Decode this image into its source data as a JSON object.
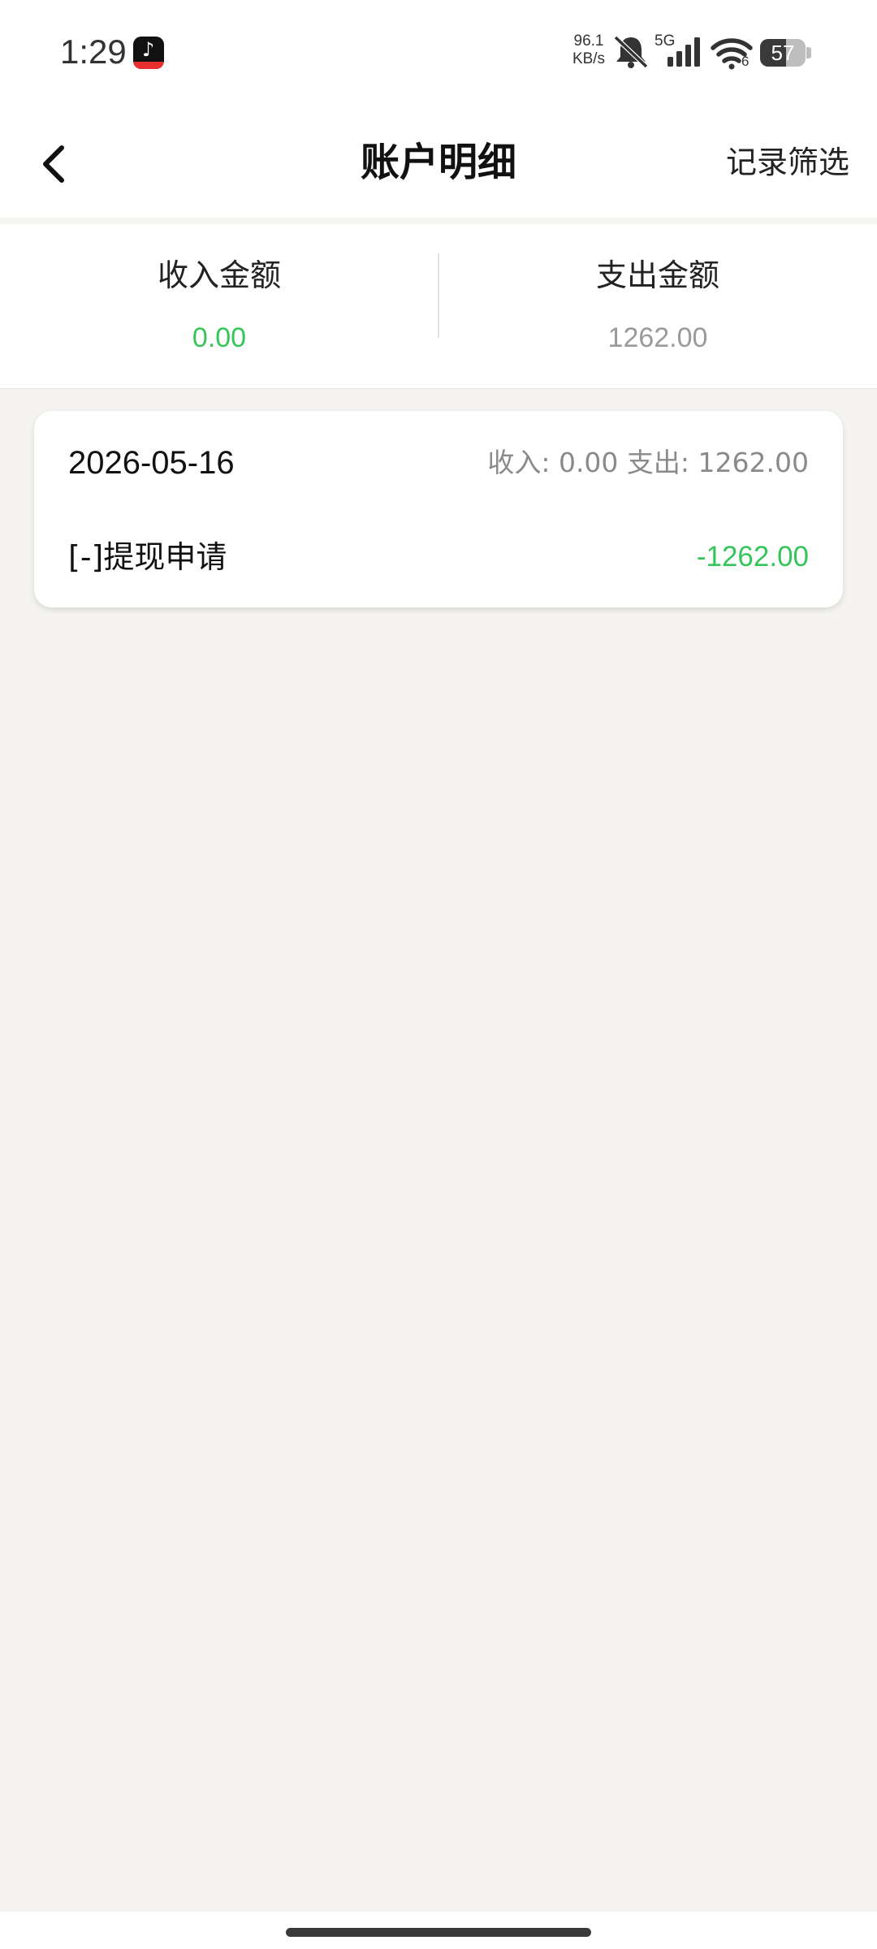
{
  "status_bar": {
    "time": "1:29",
    "net_speed_value": "96.1",
    "net_speed_unit": "KB/s",
    "network_type": "5G",
    "wifi_label": "6",
    "battery_level": "57",
    "battery_fraction": 0.57,
    "icons": [
      "app-notification-icon",
      "mute-icon",
      "signal-icon",
      "wifi-icon",
      "battery-icon"
    ]
  },
  "header": {
    "title": "账户明细",
    "filter_label": "记录筛选",
    "back_icon": "chevron-left-icon"
  },
  "summary": {
    "income_label": "收入金额",
    "income_value": "0.00",
    "expense_label": "支出金额",
    "expense_value": "1262.00"
  },
  "records": [
    {
      "date": "2026-05-16",
      "totals": "收入: 0.00 支出: 1262.00",
      "items": [
        {
          "label": "[-]提现申请",
          "amount": "-1262.00"
        }
      ]
    }
  ],
  "colors": {
    "income_green": "#36c55b",
    "expense_grey": "#9a9a9a",
    "amount_green": "#36c55b",
    "background": "#f5f4f0"
  }
}
